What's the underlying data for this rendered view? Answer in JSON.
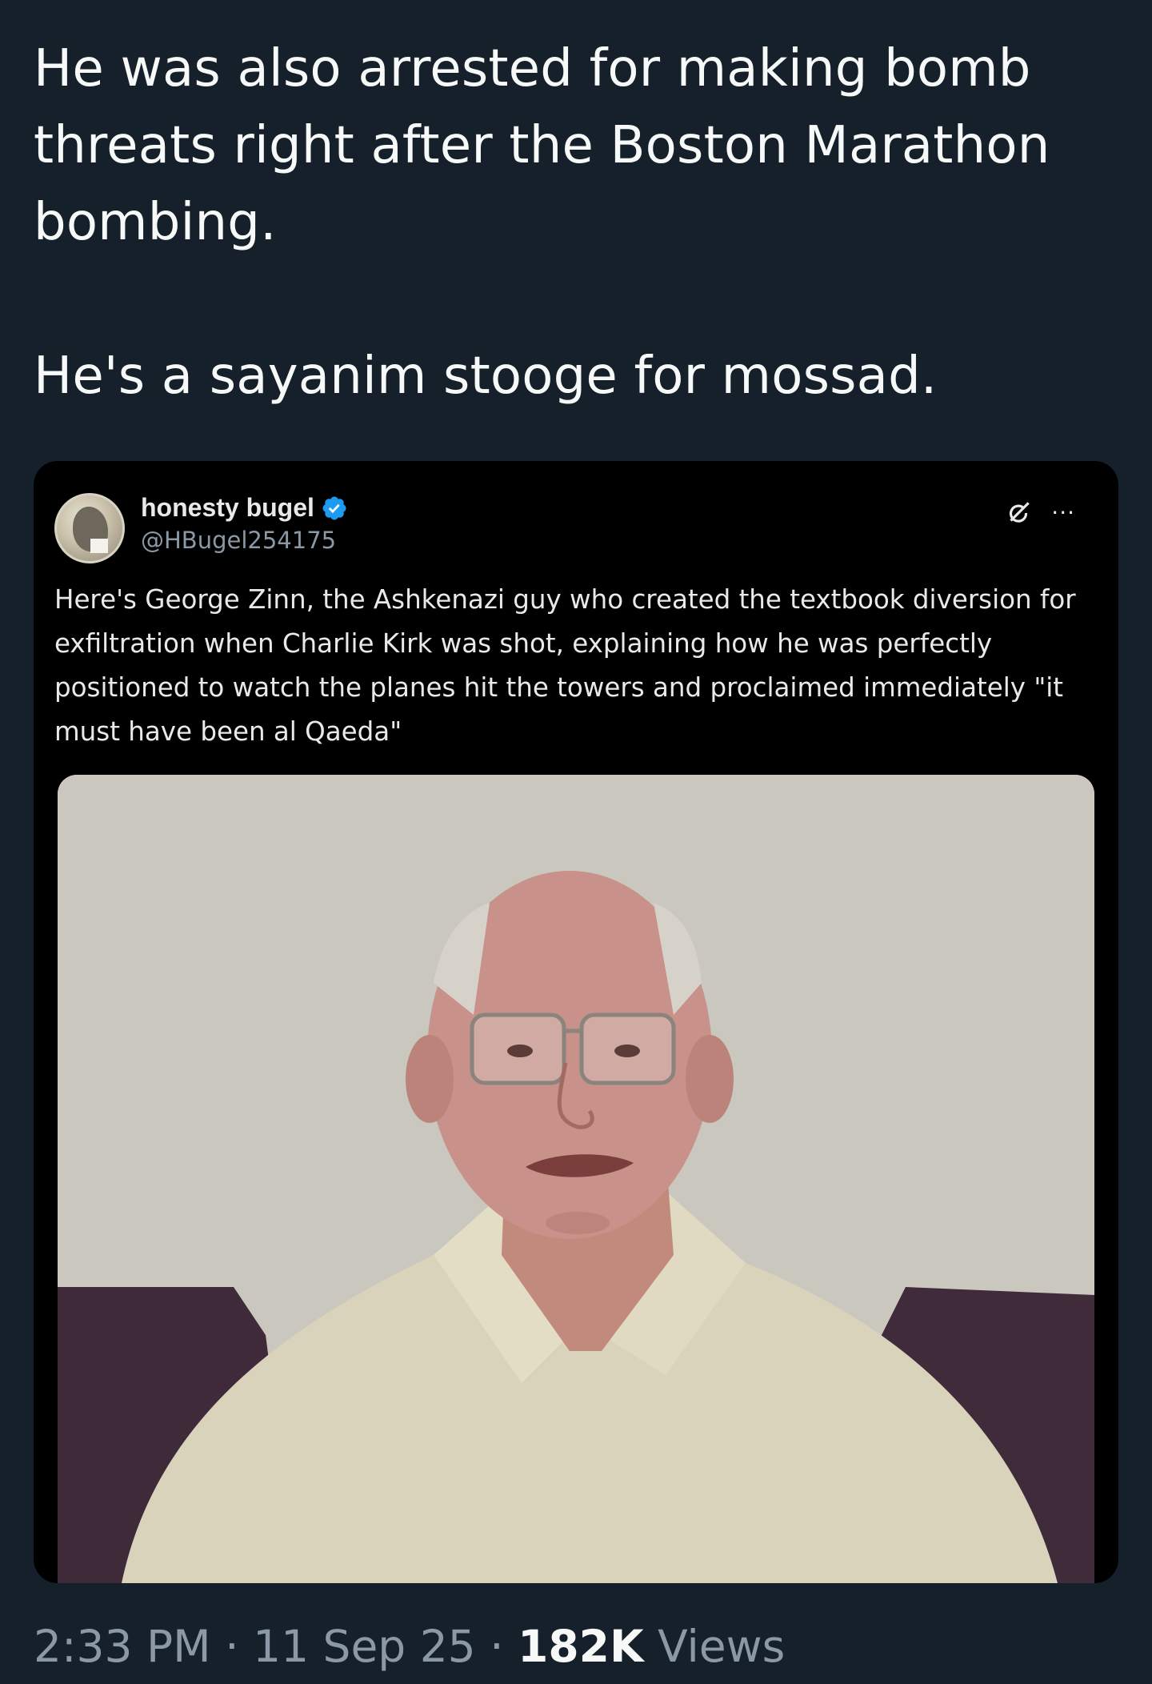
{
  "tweet": {
    "paragraphs": [
      "He was also arrested for making bomb threats right after the Boston Marathon bombing.",
      "He's a sayanim stooge for mossad."
    ],
    "time": "2:33 PM",
    "separator": "·",
    "date": "11 Sep 25",
    "views_count": "182K",
    "views_label": "Views"
  },
  "quoted": {
    "display_name": "honesty bugel",
    "handle": "@HBugel254175",
    "verified": true,
    "text": "Here's George Zinn, the Ashkenazi guy who created the textbook diversion for exfiltration when Charlie Kirk was shot, explaining how he was perfectly positioned to watch the planes hit the towers and proclaimed immediately \"it must have been al Qaeda\"",
    "icons": [
      "grok-icon",
      "more-icon"
    ],
    "media": "photo of an older man with glasses in a light shirt"
  },
  "colors": {
    "background": "#15202b",
    "card": "#000000",
    "verified": "#1d9bf0",
    "muted": "#8b98a5",
    "text": "#f7f9f9"
  }
}
